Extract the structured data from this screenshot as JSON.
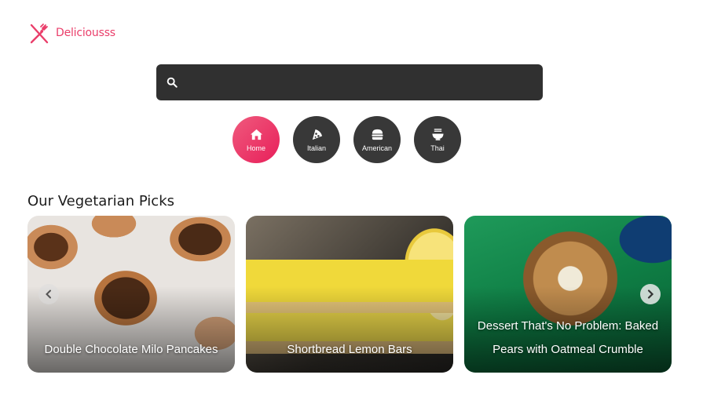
{
  "brand": {
    "name": "Deliciousss",
    "icon": "fork-knife-icon",
    "color": "#ea3e6a"
  },
  "search": {
    "placeholder": "",
    "value": "",
    "icon": "search-icon"
  },
  "categories": [
    {
      "label": "Home",
      "icon": "home-icon",
      "active": true
    },
    {
      "label": "Italian",
      "icon": "pizza-icon",
      "active": false
    },
    {
      "label": "American",
      "icon": "hamburger-icon",
      "active": false
    },
    {
      "label": "Thai",
      "icon": "noodle-bowl-icon",
      "active": false
    }
  ],
  "section": {
    "title": "Our Vegetarian Picks"
  },
  "cards": [
    {
      "title": "Double Chocolate Milo Pancakes"
    },
    {
      "title": "Shortbread Lemon Bars"
    },
    {
      "title": "Dessert That's No Problem: Baked Pears with Oatmeal Crumble"
    }
  ],
  "carousel": {
    "prev_icon": "chevron-left-icon",
    "next_icon": "chevron-right-icon"
  },
  "colors": {
    "accent": "#e8285e",
    "dark": "#303030"
  }
}
